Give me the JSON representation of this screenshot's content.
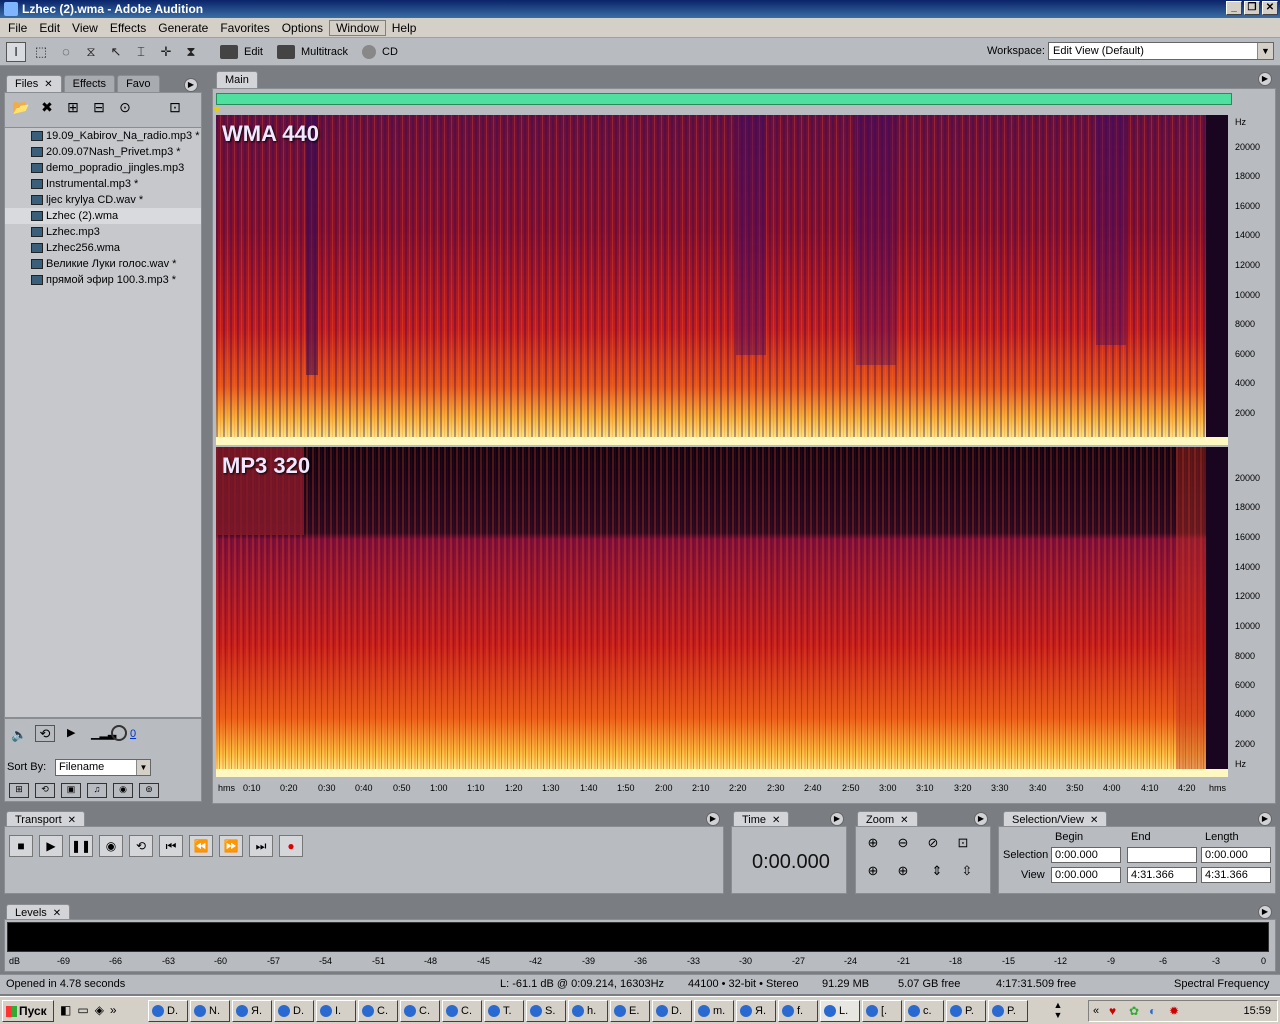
{
  "window": {
    "title": "Lzhec (2).wma - Adobe Audition"
  },
  "menu": [
    "File",
    "Edit",
    "View",
    "Effects",
    "Generate",
    "Favorites",
    "Options",
    "Window",
    "Help"
  ],
  "toolbar": {
    "modes": [
      "Edit",
      "Multitrack",
      "CD"
    ],
    "workspace_label": "Workspace:",
    "workspace_value": "Edit View (Default)"
  },
  "files_panel": {
    "tabs": [
      "Files",
      "Effects",
      "Favo"
    ],
    "files": [
      "19.09_Kabirov_Na_radio.mp3 *",
      "20.09.07Nash_Privet.mp3 *",
      "demo_popradio_jingles.mp3",
      "Instrumental.mp3 *",
      "ljec krylya CD.wav *",
      "Lzhec (2).wma",
      "Lzhec.mp3",
      "Lzhec256.wma",
      "Великие Луки голос.wav *",
      "прямой эфир 100.3.mp3 *"
    ],
    "selected_index": 5,
    "volume_value": "0",
    "sort_by_label": "Sort By:",
    "sort_by_value": "Filename"
  },
  "main": {
    "tab": "Main",
    "track1_label": "WMA 440",
    "track2_label": "MP3 320",
    "hz_unit": "Hz",
    "hz_ticks": [
      "20000",
      "18000",
      "16000",
      "14000",
      "12000",
      "10000",
      "8000",
      "6000",
      "4000",
      "2000"
    ],
    "time_unit": "hms",
    "time_ticks": [
      "0:10",
      "0:20",
      "0:30",
      "0:40",
      "0:50",
      "1:00",
      "1:10",
      "1:20",
      "1:30",
      "1:40",
      "1:50",
      "2:00",
      "2:10",
      "2:20",
      "2:30",
      "2:40",
      "2:50",
      "3:00",
      "3:10",
      "3:20",
      "3:30",
      "3:40",
      "3:50",
      "4:00",
      "4:10",
      "4:20"
    ]
  },
  "transport": {
    "tab": "Transport"
  },
  "time_panel": {
    "tab": "Time",
    "value": "0:00.000"
  },
  "zoom_panel": {
    "tab": "Zoom"
  },
  "selection_view": {
    "tab": "Selection/View",
    "col_begin": "Begin",
    "col_end": "End",
    "col_length": "Length",
    "row_selection": "Selection",
    "row_view": "View",
    "selection_begin": "0:00.000",
    "selection_end": "",
    "selection_length": "0:00.000",
    "view_begin": "0:00.000",
    "view_end": "4:31.366",
    "view_length": "4:31.366"
  },
  "levels": {
    "tab": "Levels",
    "db_ticks": [
      "dB",
      "-69",
      "-66",
      "-63",
      "-60",
      "-57",
      "-54",
      "-51",
      "-48",
      "-45",
      "-42",
      "-39",
      "-36",
      "-33",
      "-30",
      "-27",
      "-24",
      "-21",
      "-18",
      "-15",
      "-12",
      "-9",
      "-6",
      "-3",
      "0"
    ]
  },
  "status": {
    "opened": "Opened in 4.78 seconds",
    "cursor": "L: -61.1 dB @   0:09.214, 16303Hz",
    "format": "44100 • 32-bit • Stereo",
    "size": "91.29 MB",
    "free": "5.07 GB free",
    "time_free": "4:17:31.509 free",
    "view_mode": "Spectral Frequency"
  },
  "taskbar": {
    "start": "Пуск",
    "items": [
      "D.",
      "N.",
      "Я.",
      "D.",
      "I.",
      "C.",
      "C.",
      "C.",
      "T.",
      "S.",
      "h.",
      "E.",
      "D.",
      "m.",
      "Я.",
      "f.",
      "L.",
      "[.",
      "c.",
      "P.",
      "P."
    ],
    "clock": "15:59"
  }
}
